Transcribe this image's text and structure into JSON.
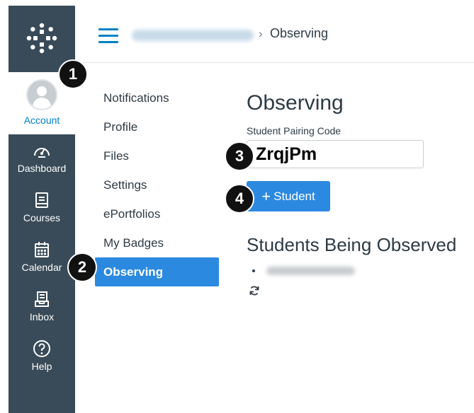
{
  "header": {
    "breadcrumb_current": "Observing",
    "breadcrumb_separator": "›"
  },
  "global_nav": {
    "account_label": "Account",
    "items": [
      {
        "label": "Dashboard",
        "icon": "dashboard-icon"
      },
      {
        "label": "Courses",
        "icon": "courses-icon"
      },
      {
        "label": "Calendar",
        "icon": "calendar-icon"
      },
      {
        "label": "Inbox",
        "icon": "inbox-icon"
      },
      {
        "label": "Help",
        "icon": "help-icon"
      }
    ]
  },
  "subnav": {
    "items": [
      {
        "label": "Notifications"
      },
      {
        "label": "Profile"
      },
      {
        "label": "Files"
      },
      {
        "label": "Settings"
      },
      {
        "label": "ePortfolios"
      },
      {
        "label": "My Badges"
      },
      {
        "label": "Observing",
        "active": true
      }
    ]
  },
  "content": {
    "title": "Observing",
    "pairing_label": "Student Pairing Code",
    "pairing_value": "ZrqjPm",
    "add_button_plus": "+",
    "add_button_label": "Student",
    "section_title": "Students Being Observed"
  },
  "callouts": [
    "1",
    "2",
    "3",
    "4"
  ],
  "colors": {
    "nav_bg": "#394b58",
    "accent": "#2c89e0",
    "link": "#0081c6",
    "text": "#2d3b45"
  }
}
